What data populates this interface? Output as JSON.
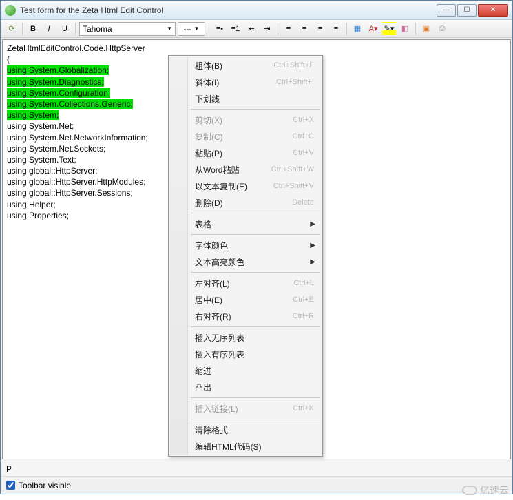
{
  "window": {
    "title": "Test form for the Zeta Html Edit Control"
  },
  "toolbar": {
    "font_name": "Tahoma",
    "size_label": "---"
  },
  "editor": {
    "namespace_line": "ZetaHtmlEditControl.Code.HttpServer",
    "brace": "{",
    "highlighted": [
      "using System.Globalization;",
      "using System.Diagnostics;",
      "using System.Configuration;",
      "using System.Collections.Generic;",
      "using System;"
    ],
    "plain": [
      "using System.Net;",
      "using System.Net.NetworkInformation;",
      "using System.Net.Sockets;",
      "using System.Text;",
      "using global::HttpServer;",
      "using global::HttpServer.HttpModules;",
      "using global::HttpServer.Sessions;",
      "using Helper;",
      "using Properties;"
    ]
  },
  "context_menu": [
    {
      "icon": "bold",
      "label": "粗体(B)",
      "shortcut": "Ctrl+Shift+F",
      "disabled": false
    },
    {
      "icon": "italic",
      "label": "斜体(I)",
      "shortcut": "Ctrl+Shift+I",
      "disabled": false
    },
    {
      "icon": "underline",
      "label": "下划线",
      "shortcut": "",
      "disabled": false
    },
    {
      "sep": true
    },
    {
      "icon": "cut",
      "label": "剪切(X)",
      "shortcut": "Ctrl+X",
      "disabled": true
    },
    {
      "icon": "copy",
      "label": "复制(C)",
      "shortcut": "Ctrl+C",
      "disabled": true
    },
    {
      "icon": "paste",
      "label": "粘贴(P)",
      "shortcut": "Ctrl+V",
      "disabled": false
    },
    {
      "icon": "paste-word",
      "label": "从Word粘贴",
      "shortcut": "Ctrl+Shift+W",
      "disabled": false
    },
    {
      "icon": "copy-text",
      "label": "以文本复制(E)",
      "shortcut": "Ctrl+Shift+V",
      "disabled": false
    },
    {
      "icon": "delete",
      "label": "删除(D)",
      "shortcut": "Delete",
      "disabled": false
    },
    {
      "sep": true
    },
    {
      "icon": "table",
      "label": "表格",
      "submenu": true,
      "disabled": false
    },
    {
      "sep": true
    },
    {
      "icon": "font-color",
      "label": "字体颜色",
      "submenu": true,
      "disabled": false
    },
    {
      "icon": "highlight",
      "label": "文本高亮颜色",
      "submenu": true,
      "disabled": false
    },
    {
      "sep": true
    },
    {
      "icon": "align-left",
      "label": "左对齐(L)",
      "shortcut": "Ctrl+L",
      "disabled": false
    },
    {
      "icon": "align-center",
      "label": "居中(E)",
      "shortcut": "Ctrl+E",
      "disabled": false
    },
    {
      "icon": "align-right",
      "label": "右对齐(R)",
      "shortcut": "Ctrl+R",
      "disabled": false
    },
    {
      "sep": true
    },
    {
      "icon": "ul",
      "label": "插入无序列表",
      "disabled": false
    },
    {
      "icon": "ol",
      "label": "插入有序列表",
      "disabled": false
    },
    {
      "icon": "indent",
      "label": "缩进",
      "disabled": false
    },
    {
      "icon": "outdent",
      "label": "凸出",
      "disabled": false
    },
    {
      "sep": true
    },
    {
      "icon": "link",
      "label": "插入链接(L)",
      "shortcut": "Ctrl+K",
      "disabled": true
    },
    {
      "sep": true
    },
    {
      "icon": "eraser",
      "label": "清除格式",
      "disabled": false
    },
    {
      "icon": "html",
      "label": "编辑HTML代码(S)",
      "disabled": false
    }
  ],
  "status": {
    "text": "P"
  },
  "checkbox": {
    "label": "Toolbar visible",
    "checked": true
  },
  "watermark": "亿速云"
}
